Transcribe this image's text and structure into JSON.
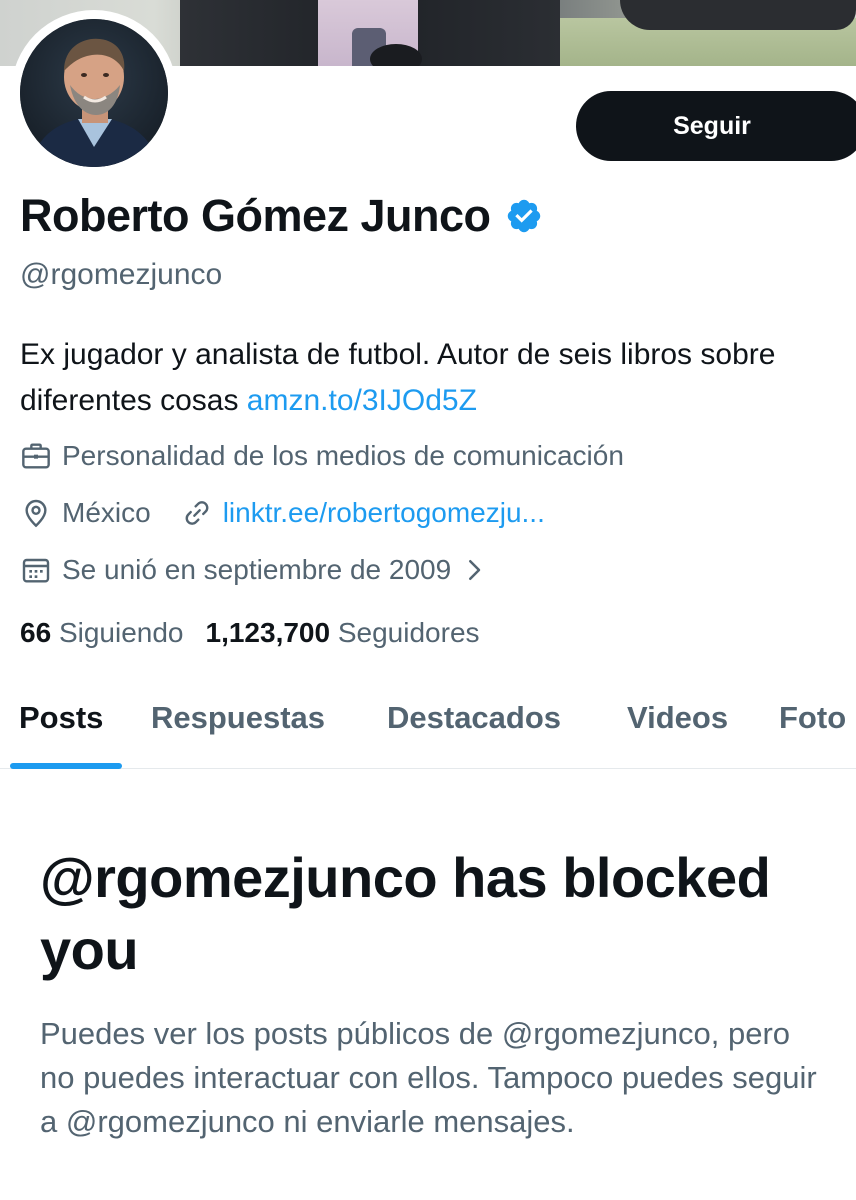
{
  "profile": {
    "name": "Roberto Gómez Junco",
    "handle": "@rgomezjunco",
    "bio_text": "Ex jugador y analista de futbol. Autor de seis libros sobre diferentes cosas ",
    "bio_link": "amzn.to/3IJOd5Z",
    "category": "Personalidad de los medios de comunicación",
    "location": "México",
    "website": "linktr.ee/robertogomezju...",
    "joined": "Se unió en septiembre de 2009",
    "following_count": "66",
    "following_label": "Siguiendo",
    "followers_count": "1,123,700",
    "followers_label": "Seguidores"
  },
  "actions": {
    "follow_label": "Seguir"
  },
  "tabs": [
    {
      "label": "Posts",
      "active": true
    },
    {
      "label": "Respuestas",
      "active": false
    },
    {
      "label": "Destacados",
      "active": false
    },
    {
      "label": "Videos",
      "active": false
    },
    {
      "label": "Foto",
      "active": false
    }
  ],
  "blocked": {
    "title": "@rgomezjunco has blocked you",
    "description": "Puedes ver los posts públicos de @rgomezjunco, pero no puedes interactuar con ellos. Tampoco puedes seguir a @rgomezjunco ni enviarle mensajes."
  },
  "icons": {
    "verified": "verified-badge-icon",
    "category": "briefcase-icon",
    "location": "location-pin-icon",
    "website": "link-icon",
    "joined": "calendar-icon",
    "joined_more": "chevron-right-icon"
  },
  "colors": {
    "accent": "#1d9bf0",
    "text_primary": "#0f1419",
    "text_secondary": "#536471",
    "button_bg": "#0f1419"
  }
}
